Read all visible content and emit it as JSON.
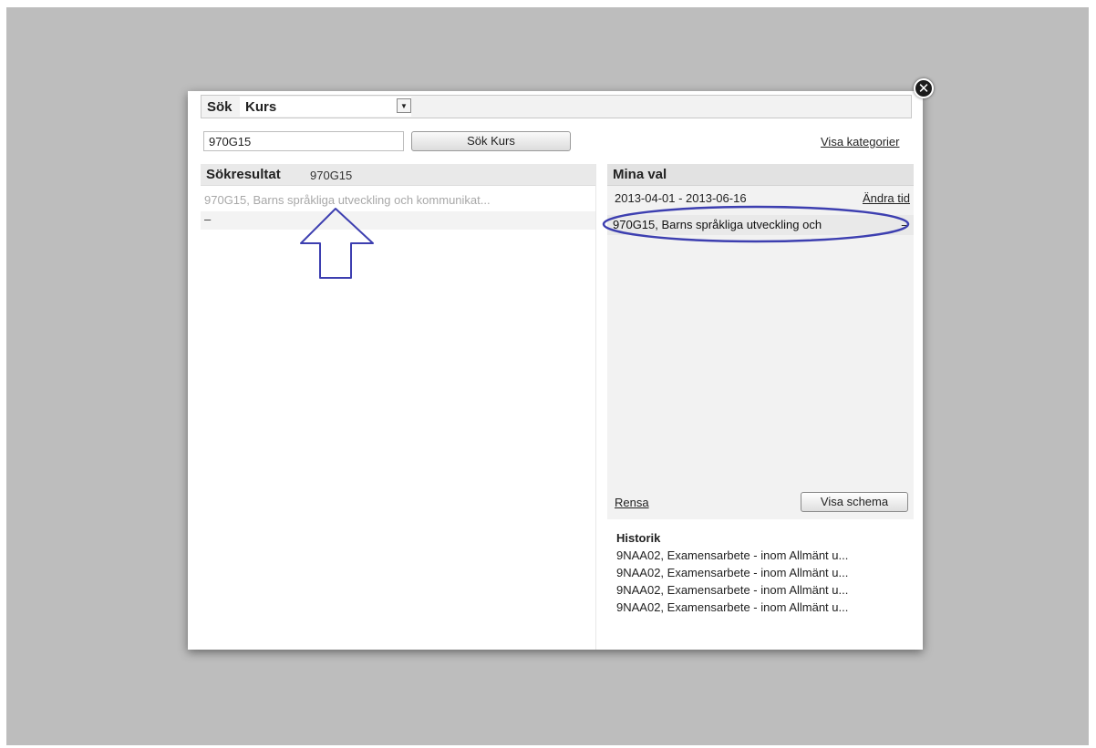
{
  "search": {
    "label": "Sök",
    "type_value": "Kurs",
    "input_value": "970G15",
    "button_label": "Sök Kurs",
    "categories_link": "Visa kategorier"
  },
  "results": {
    "title": "Sökresultat",
    "term": "970G15",
    "items": [
      {
        "label": "970G15, Barns språkliga utveckling och kommunikat...",
        "remove": "–"
      }
    ]
  },
  "my_choices": {
    "title": "Mina val",
    "date_range": "2013-04-01 - 2013-06-16",
    "change_time_link": "Ändra tid",
    "items": [
      {
        "label": "970G15, Barns språkliga utveckling och",
        "remove": "–"
      }
    ],
    "clear_link": "Rensa",
    "schedule_button": "Visa schema"
  },
  "history": {
    "title": "Historik",
    "items": [
      "9NAA02, Examensarbete - inom Allmänt u...",
      "9NAA02, Examensarbete - inom Allmänt u...",
      "9NAA02, Examensarbete - inom Allmänt u...",
      "9NAA02, Examensarbete - inom Allmänt u..."
    ]
  },
  "annotation_color": "#3d3fb0"
}
